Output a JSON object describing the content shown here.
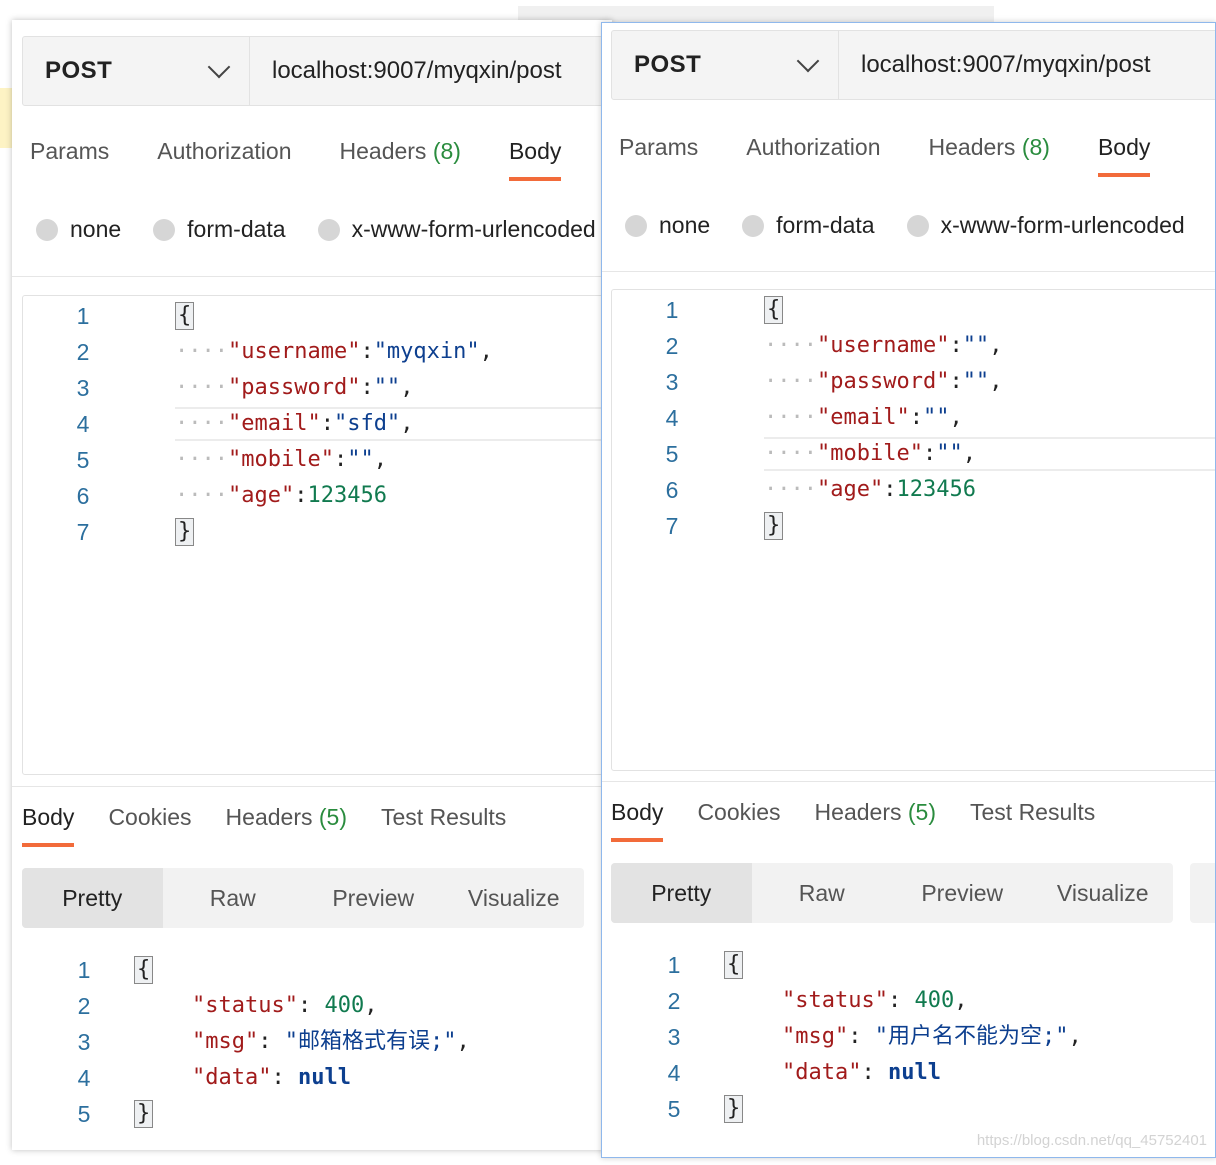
{
  "panels": [
    {
      "method": "POST",
      "url": "localhost:9007/myqxin/post",
      "tabs": {
        "params": "Params",
        "authorization": "Authorization",
        "headers": "Headers",
        "headers_count": "(8)",
        "body": "Body"
      },
      "body_types": {
        "none": "none",
        "form_data": "form-data",
        "urlencoded": "x-www-form-urlencoded"
      },
      "request_lines": [
        {
          "num": "1"
        },
        {
          "num": "2"
        },
        {
          "num": "3"
        },
        {
          "num": "4"
        },
        {
          "num": "5"
        },
        {
          "num": "6"
        },
        {
          "num": "7"
        }
      ],
      "request": {
        "username_key": "\"username\"",
        "username_val": "\"myqxin\"",
        "password_key": "\"password\"",
        "password_val": "\"\"",
        "email_key": "\"email\"",
        "email_val": "\"sfd\"",
        "mobile_key": "\"mobile\"",
        "mobile_val": "\"\"",
        "age_key": "\"age\"",
        "age_val": "123456"
      },
      "resp_tabs": {
        "body": "Body",
        "cookies": "Cookies",
        "headers": "Headers",
        "headers_count": "(5)",
        "tests": "Test Results"
      },
      "views": {
        "pretty": "Pretty",
        "raw": "Raw",
        "preview": "Preview",
        "visualize": "Visualize"
      },
      "response": {
        "status_key": "\"status\"",
        "status_val": "400",
        "msg_key": "\"msg\"",
        "msg_val": "\"邮箱格式有误;\"",
        "data_key": "\"data\"",
        "data_val": "null"
      }
    },
    {
      "method": "POST",
      "url": "localhost:9007/myqxin/post",
      "tabs": {
        "params": "Params",
        "authorization": "Authorization",
        "headers": "Headers",
        "headers_count": "(8)",
        "body": "Body"
      },
      "body_types": {
        "none": "none",
        "form_data": "form-data",
        "urlencoded": "x-www-form-urlencoded"
      },
      "request": {
        "username_key": "\"username\"",
        "username_val": "\"\"",
        "password_key": "\"password\"",
        "password_val": "\"\"",
        "email_key": "\"email\"",
        "email_val": "\"\"",
        "mobile_key": "\"mobile\"",
        "mobile_val": "\"\"",
        "age_key": "\"age\"",
        "age_val": "123456"
      },
      "resp_tabs": {
        "body": "Body",
        "cookies": "Cookies",
        "headers": "Headers",
        "headers_count": "(5)",
        "tests": "Test Results"
      },
      "views": {
        "pretty": "Pretty",
        "raw": "Raw",
        "preview": "Preview",
        "visualize": "Visualize"
      },
      "response": {
        "status_key": "\"status\"",
        "status_val": "400",
        "msg_key": "\"msg\"",
        "msg_val": "\"用户名不能为空;\"",
        "data_key": "\"data\"",
        "data_val": "null"
      }
    }
  ],
  "watermark": "https://blog.csdn.net/qq_45752401",
  "line_numbers": [
    "1",
    "2",
    "3",
    "4",
    "5",
    "6",
    "7"
  ]
}
